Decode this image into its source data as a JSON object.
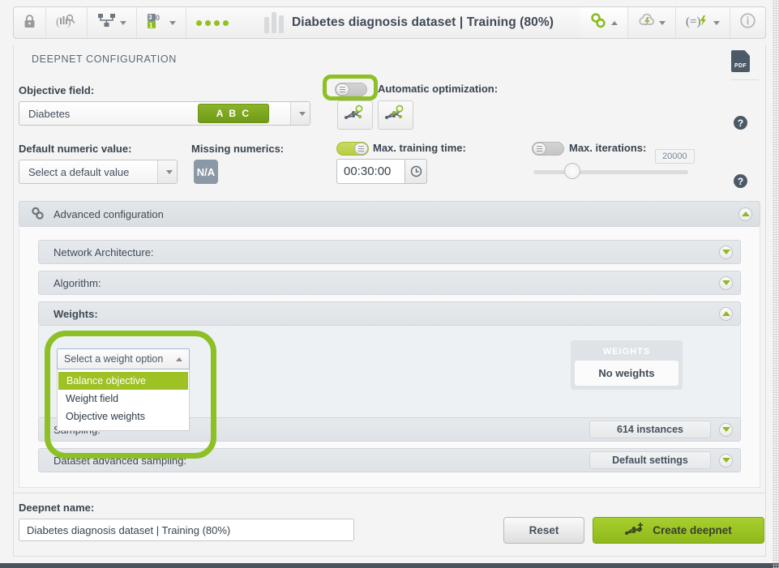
{
  "window": {
    "title": "Diabetes diagnosis dataset | Training (80%)",
    "toolbar": {
      "lock_icon": "lock-icon",
      "source_icon": "source-search-icon",
      "dataset_icon": "dataset-icon",
      "model_icon": "supervised-model-icon",
      "dots_icon": "four-dots-icon",
      "bars_icon": "dataset-bars-icon",
      "gears_icon": "gears-icon",
      "flash_icon": "cloud-flash-icon",
      "script_icon": "script-flash-icon",
      "info_icon": "info-icon"
    }
  },
  "panel": {
    "section_title": "DEEPNET CONFIGURATION",
    "pdf_label": "PDF",
    "help_icon": "question-mark-icon"
  },
  "objective": {
    "label": "Objective field:",
    "value": "Diabetes",
    "badge": "A B C"
  },
  "auto_optimization": {
    "label": "Automatic optimization:",
    "toggle_state": "off",
    "button_structure_icon": "network-structure-search-icon",
    "button_params_icon": "network-params-search-icon"
  },
  "default_numeric": {
    "label": "Default numeric value:",
    "placeholder": "Select a default value"
  },
  "missing_numerics": {
    "label": "Missing numerics:",
    "value": "N/A"
  },
  "max_training_time": {
    "label": "Max. training time:",
    "toggle_state": "on",
    "value": "00:30:00",
    "clock_icon": "clock-icon"
  },
  "max_iterations": {
    "label": "Max. iterations:",
    "toggle_state": "off",
    "value": "20000",
    "slider_percent": 20
  },
  "advanced": {
    "title": "Advanced configuration",
    "gear_icon": "gears-icon",
    "rows": [
      {
        "label": "Network Architecture:",
        "state": "collapsed",
        "pill": ""
      },
      {
        "label": "Algorithm:",
        "state": "collapsed",
        "pill": ""
      },
      {
        "label": "Weights:",
        "state": "expanded",
        "pill": ""
      },
      {
        "label": "Sampling:",
        "state": "collapsed",
        "pill": "614 instances"
      },
      {
        "label": "Dataset advanced sampling:",
        "state": "collapsed",
        "pill": "Default settings"
      }
    ]
  },
  "weights_dropdown": {
    "selected_label": "Select a weight option",
    "options": [
      "Balance objective",
      "Weight field",
      "Objective weights"
    ],
    "highlighted": "Balance objective"
  },
  "weights_card": {
    "header": "WEIGHTS",
    "body": "No weights"
  },
  "deepnet_name": {
    "label": "Deepnet name:",
    "value": "Diabetes diagnosis dataset | Training (80%)"
  },
  "actions": {
    "reset": "Reset",
    "create": "Create deepnet",
    "create_icon": "network-plus-icon"
  },
  "colors": {
    "accent_green": "#8cc024",
    "badge_green": "#76a21e",
    "dark_slate": "#3f4a56"
  }
}
